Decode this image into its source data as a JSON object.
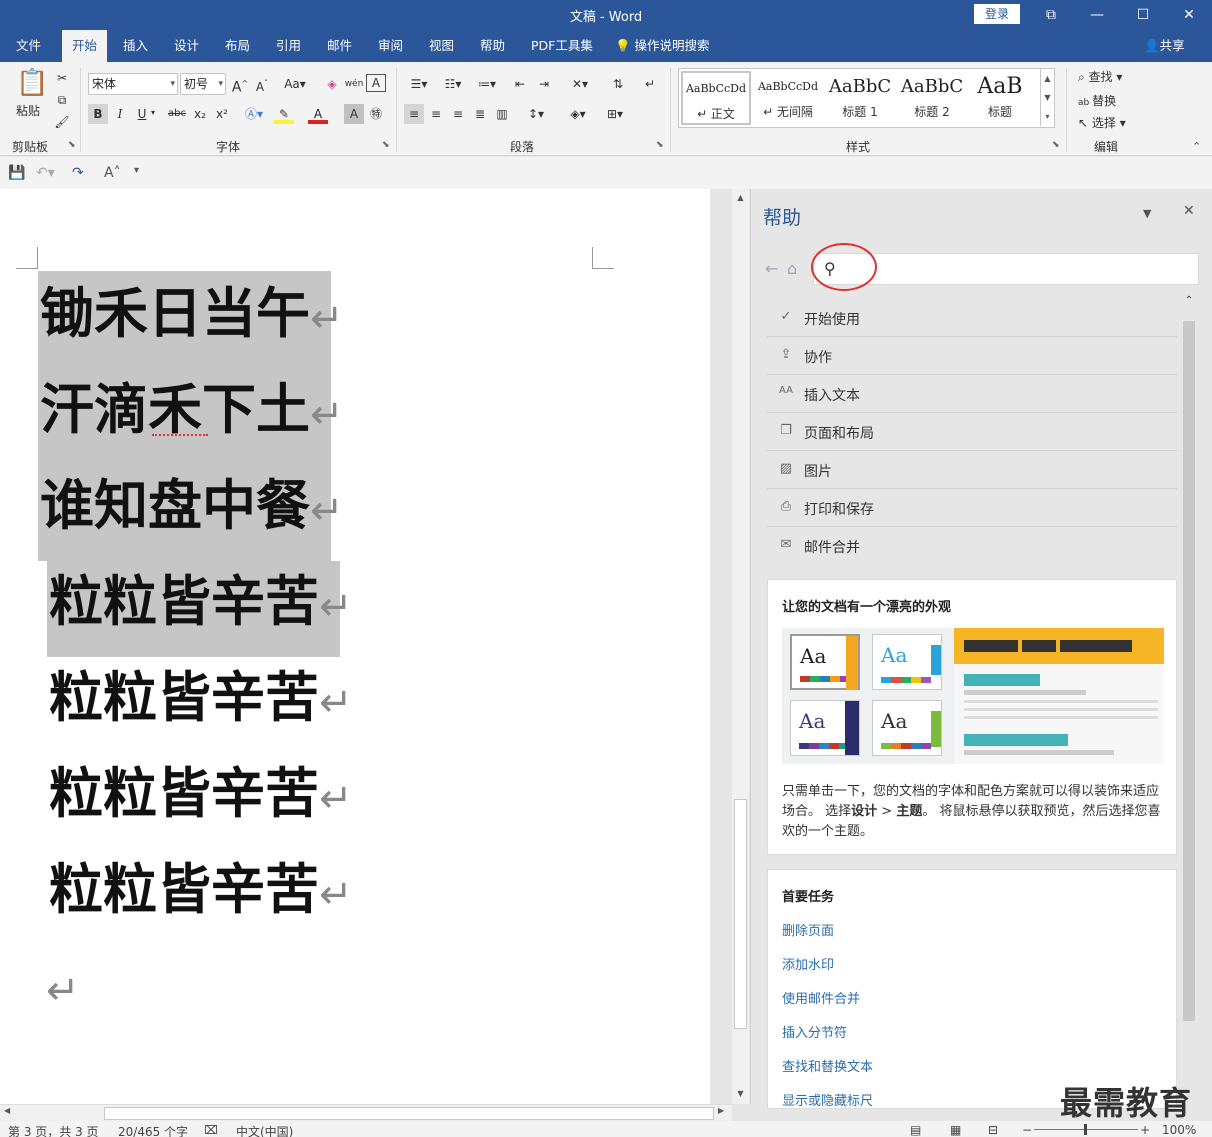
{
  "titlebar": {
    "title": "文稿  -  Word",
    "login": "登录",
    "btn_ribbon_opts": "⧉",
    "btn_min": "—",
    "btn_max": "☐",
    "btn_close": "✕"
  },
  "tabs": [
    "文件",
    "开始",
    "插入",
    "设计",
    "布局",
    "引用",
    "邮件",
    "审阅",
    "视图",
    "帮助",
    "PDF工具集"
  ],
  "active_tab": "开始",
  "tellme": "操作说明搜索",
  "share": "共享",
  "ribbon": {
    "clipboard": {
      "paste": "粘贴",
      "label": "剪贴板"
    },
    "font": {
      "name": "宋体",
      "size": "初号",
      "label": "字体",
      "bold": "B",
      "italic": "I",
      "underline": "U",
      "strike": "abc",
      "sub": "x₂",
      "sup": "x²"
    },
    "paragraph": {
      "label": "段落"
    },
    "styles": {
      "label": "样式",
      "items": [
        {
          "preview": "AaBbCcDd",
          "name": "↵ 正文"
        },
        {
          "preview": "AaBbCcDd",
          "name": "↵ 无间隔"
        },
        {
          "preview": "AaBbC",
          "name": "标题 1"
        },
        {
          "preview": "AaBbC",
          "name": "标题 2"
        },
        {
          "preview": "AaB",
          "name": "标题"
        }
      ]
    },
    "editing": {
      "label": "编辑",
      "find": "查找",
      "replace": "替换",
      "select": "选择"
    }
  },
  "document": {
    "lines": [
      "锄禾日当午",
      "汗滴禾下土",
      "谁知盘中餐",
      "粒粒皆辛苦",
      "粒粒皆辛苦",
      "粒粒皆辛苦",
      "粒粒皆辛苦"
    ],
    "paragraph_mark": "↵"
  },
  "help": {
    "title": "帮助",
    "search_placeholder": "",
    "topics": [
      "开始使用",
      "协作",
      "插入文本",
      "页面和布局",
      "图片",
      "打印和保存",
      "邮件合并"
    ],
    "card1": {
      "title": "让您的文档有一个漂亮的外观",
      "body_1": "只需单击一下，您的文档的字体和配色方案就可以得以装饰来适应场合。 选择",
      "body_bold_1": "设计",
      "body_2": " > ",
      "body_bold_2": "主题",
      "body_3": "。 将鼠标悬停以获取预览，然后选择您喜欢的一个主题。"
    },
    "card2": {
      "title": "首要任务",
      "links": [
        "删除页面",
        "添加水印",
        "使用邮件合并",
        "插入分节符",
        "查找和替换文本",
        "显示或隐藏标尺"
      ]
    }
  },
  "watermark": "最需教育",
  "status": {
    "page": "第 3 页，共 3 页",
    "words": "20/465 个字",
    "lang": "中文(中国)",
    "zoom": "100%"
  },
  "colors": {
    "brand": "#2b579a",
    "highlight": "#c6c6c6",
    "annotation": "#e03030"
  }
}
